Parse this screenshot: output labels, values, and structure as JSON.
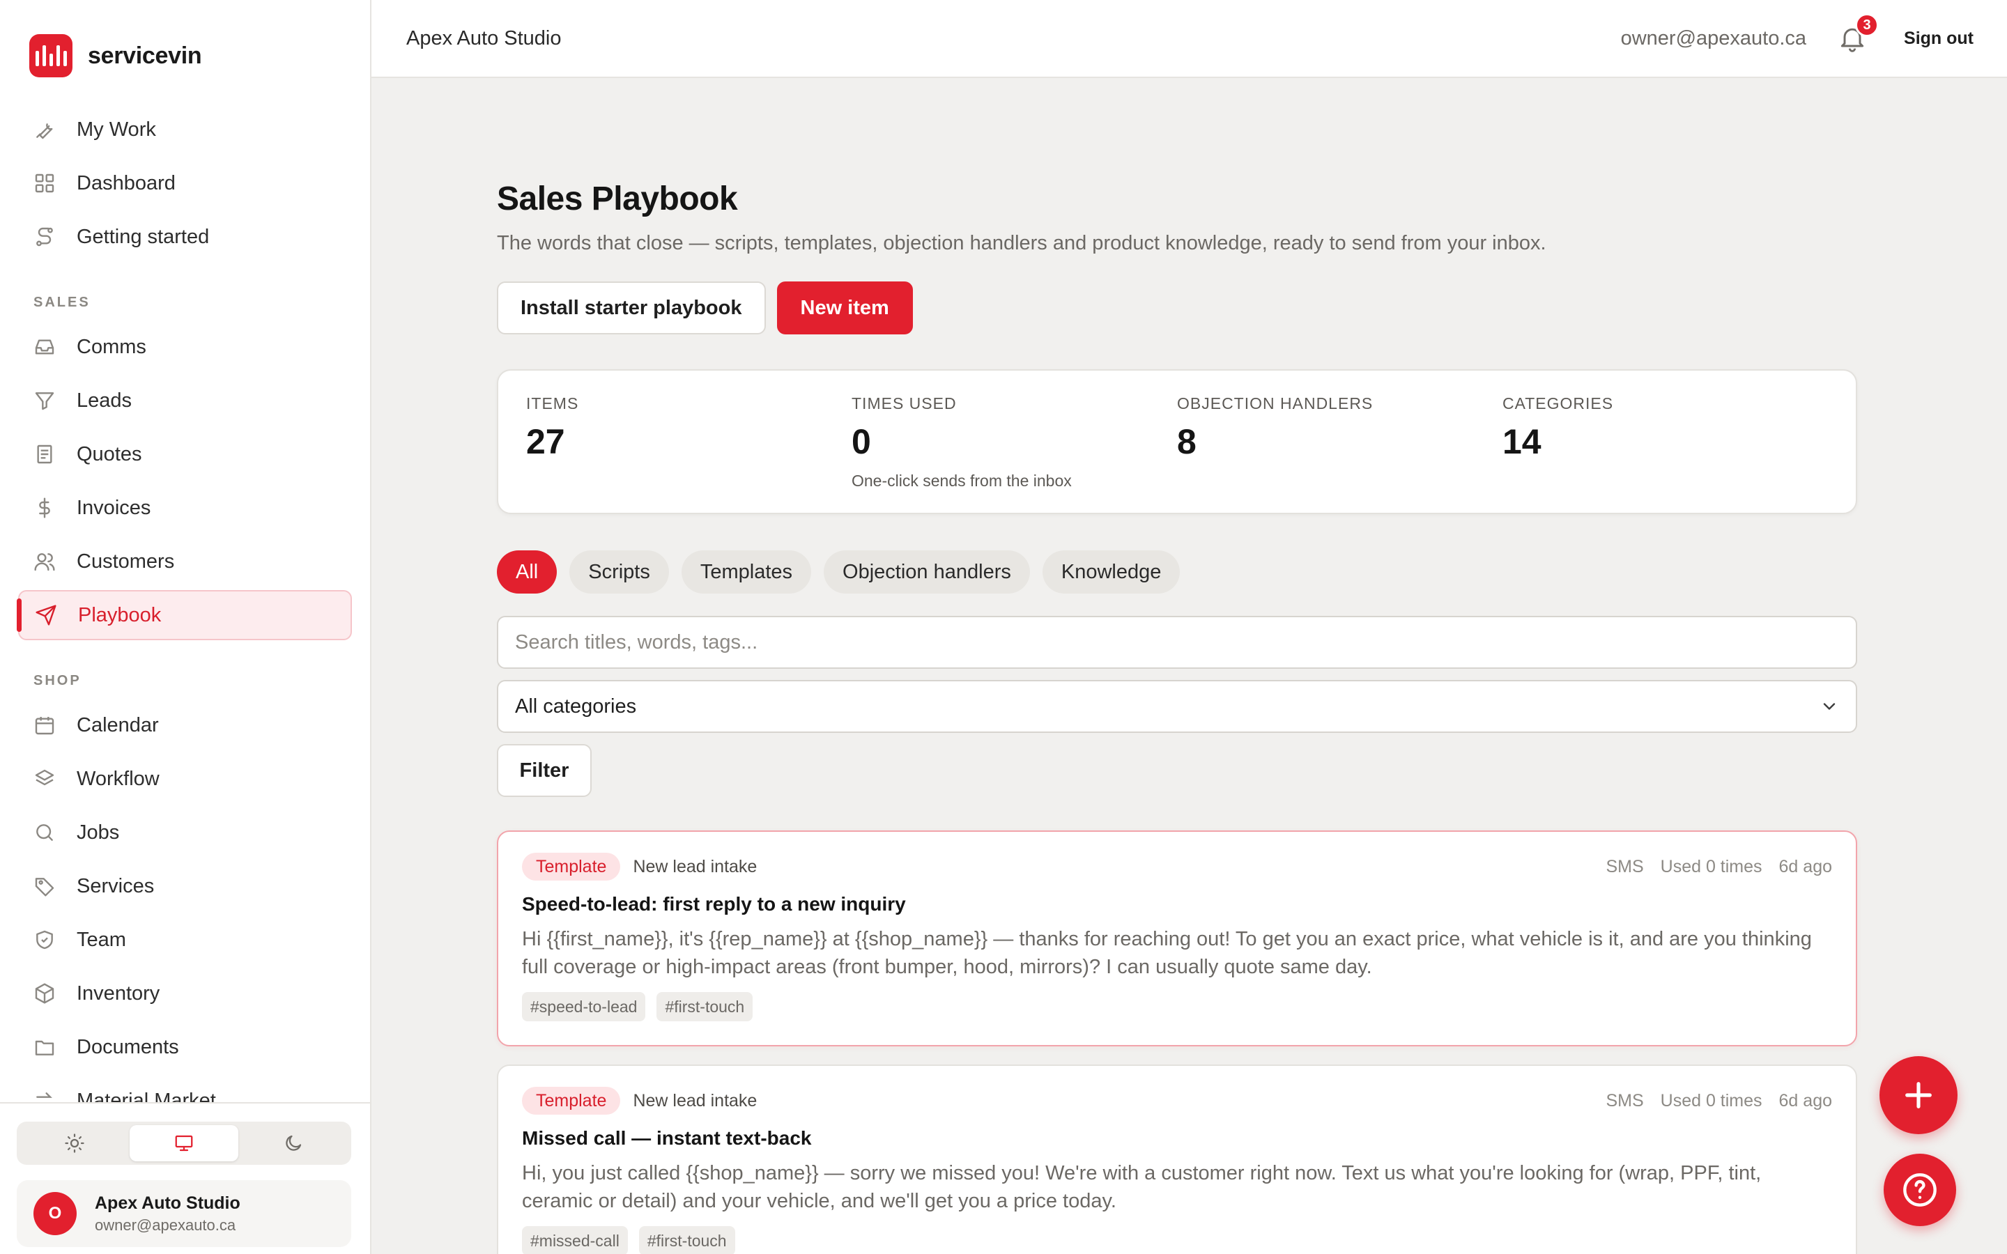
{
  "brand": {
    "name": "servicevin"
  },
  "nav": {
    "top": [
      {
        "label": "My Work",
        "icon": "wrench-icon"
      },
      {
        "label": "Dashboard",
        "icon": "grid-icon"
      },
      {
        "label": "Getting started",
        "icon": "route-icon"
      }
    ],
    "sales_heading": "SALES",
    "sales": [
      {
        "label": "Comms",
        "icon": "inbox-icon"
      },
      {
        "label": "Leads",
        "icon": "funnel-icon"
      },
      {
        "label": "Quotes",
        "icon": "receipt-icon"
      },
      {
        "label": "Invoices",
        "icon": "dollar-icon"
      },
      {
        "label": "Customers",
        "icon": "users-icon"
      },
      {
        "label": "Playbook",
        "icon": "send-icon",
        "active": true
      }
    ],
    "shop_heading": "SHOP",
    "shop": [
      {
        "label": "Calendar",
        "icon": "calendar-icon"
      },
      {
        "label": "Workflow",
        "icon": "layers-icon"
      },
      {
        "label": "Jobs",
        "icon": "search-icon"
      },
      {
        "label": "Services",
        "icon": "tag-icon"
      },
      {
        "label": "Team",
        "icon": "shield-icon"
      },
      {
        "label": "Inventory",
        "icon": "box-icon"
      },
      {
        "label": "Documents",
        "icon": "folder-icon"
      },
      {
        "label": "Material Market",
        "icon": "swap-icon"
      }
    ]
  },
  "theme": {
    "selected": "system"
  },
  "user": {
    "initial": "O",
    "name": "Apex Auto Studio",
    "email": "owner@apexauto.ca"
  },
  "topbar": {
    "title": "Apex Auto Studio",
    "email": "owner@apexauto.ca",
    "notifications": "3",
    "signout": "Sign out"
  },
  "page": {
    "title": "Sales Playbook",
    "subtitle": "The words that close — scripts, templates, objection handlers and product knowledge, ready to send from your inbox.",
    "install_label": "Install starter playbook",
    "new_label": "New item"
  },
  "stats": [
    {
      "label": "ITEMS",
      "value": "27",
      "note": ""
    },
    {
      "label": "TIMES USED",
      "value": "0",
      "note": "One-click sends from the inbox"
    },
    {
      "label": "OBJECTION HANDLERS",
      "value": "8",
      "note": ""
    },
    {
      "label": "CATEGORIES",
      "value": "14",
      "note": ""
    }
  ],
  "tabs": [
    {
      "label": "All",
      "active": true
    },
    {
      "label": "Scripts"
    },
    {
      "label": "Templates"
    },
    {
      "label": "Objection handlers"
    },
    {
      "label": "Knowledge"
    }
  ],
  "search": {
    "placeholder": "Search titles, words, tags..."
  },
  "category_select": {
    "value": "All categories"
  },
  "filter_label": "Filter",
  "items": [
    {
      "type": "Template",
      "category": "New lead intake",
      "channel": "SMS",
      "used": "Used 0 times",
      "age": "6d ago",
      "title": "Speed-to-lead: first reply to a new inquiry",
      "body": "Hi {{first_name}}, it's {{rep_name}} at {{shop_name}} — thanks for reaching out! To get you an exact price, what vehicle is it, and are you thinking full coverage or high-impact areas (front bumper, hood, mirrors)? I can usually quote same day.",
      "tags": [
        "#speed-to-lead",
        "#first-touch"
      ]
    },
    {
      "type": "Template",
      "category": "New lead intake",
      "channel": "SMS",
      "used": "Used 0 times",
      "age": "6d ago",
      "title": "Missed call — instant text-back",
      "body": "Hi, you just called {{shop_name}} — sorry we missed you! We're with a customer right now. Text us what you're looking for (wrap, PPF, tint, ceramic or detail) and your vehicle, and we'll get you a price today.",
      "tags": [
        "#missed-call",
        "#first-touch"
      ]
    }
  ],
  "colors": {
    "accent": "#e2202e",
    "accent_soft": "#fdecee"
  }
}
